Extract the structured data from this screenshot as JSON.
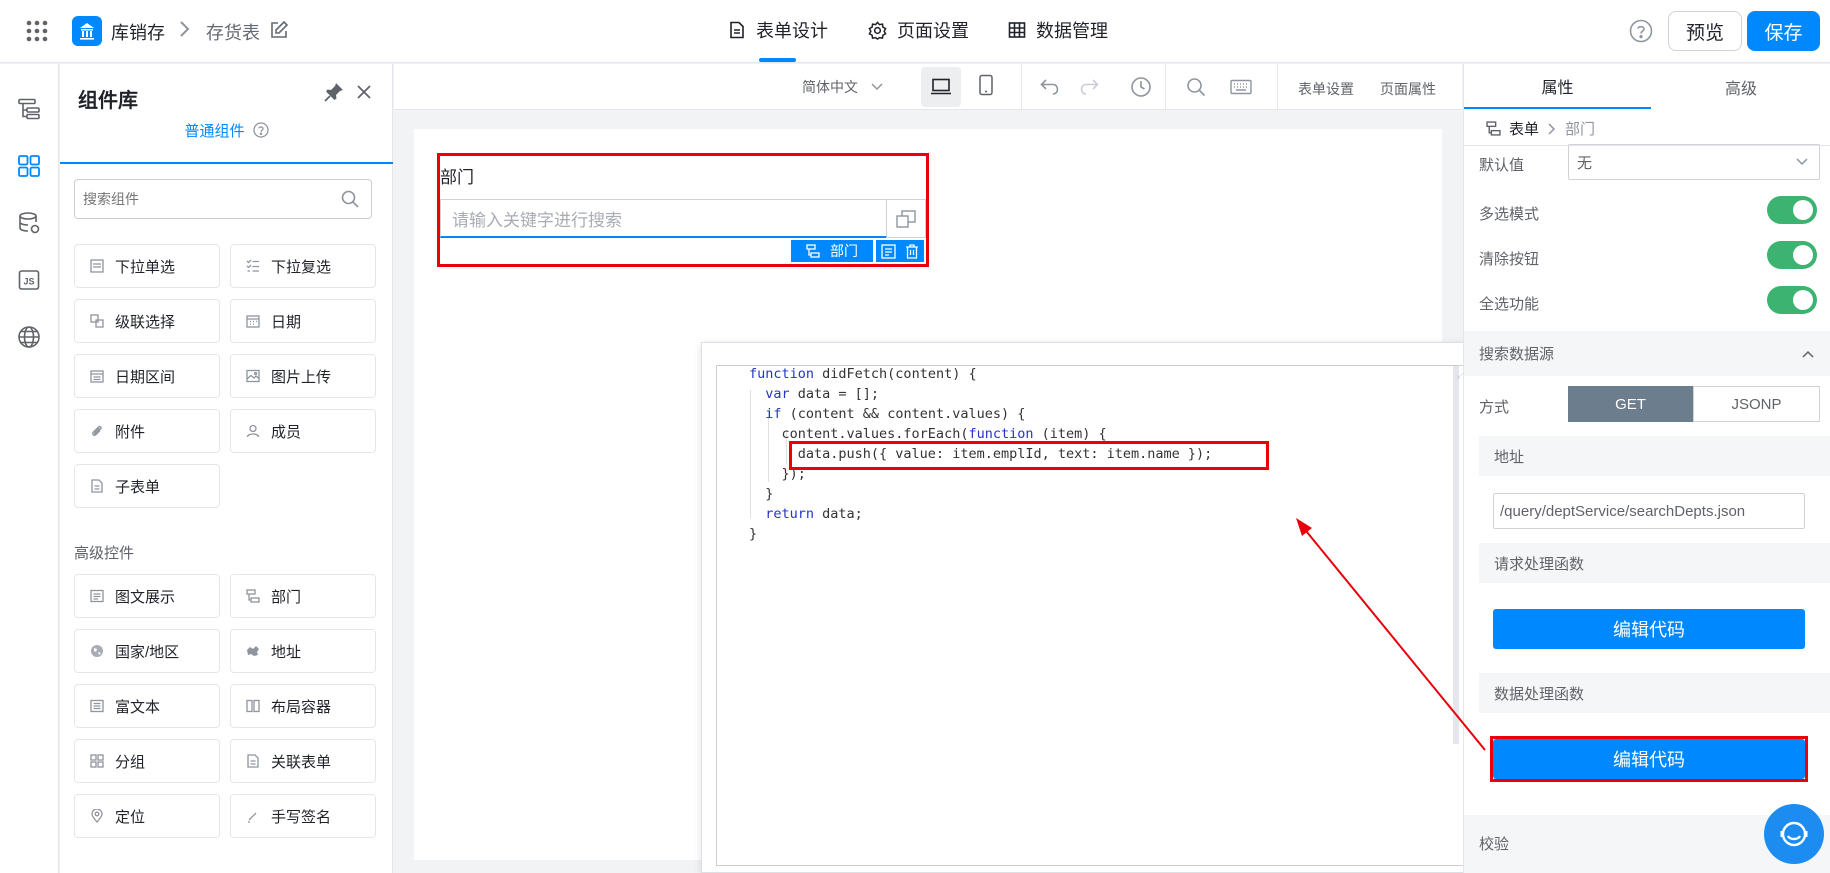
{
  "topbar": {
    "app_name": "库销存",
    "page_name": "存货表",
    "tabs": [
      {
        "label": "表单设计",
        "active": true
      },
      {
        "label": "页面设置",
        "active": false
      },
      {
        "label": "数据管理",
        "active": false
      }
    ],
    "preview_label": "预览",
    "save_label": "保存"
  },
  "panel": {
    "title": "组件库",
    "tab_label": "普通组件",
    "search_placeholder": "搜索组件",
    "basic_components": [
      "下拉单选",
      "下拉复选",
      "级联选择",
      "日期",
      "日期区间",
      "图片上传",
      "附件",
      "成员",
      "子表单"
    ],
    "advanced_title": "高级控件",
    "advanced_components": [
      "图文展示",
      "部门",
      "国家/地区",
      "地址",
      "富文本",
      "布局容器",
      "分组",
      "关联表单",
      "定位",
      "手写签名"
    ]
  },
  "canvasbar": {
    "language": "简体中文",
    "form_settings": "表单设置",
    "page_props": "页面属性"
  },
  "field": {
    "label": "部门",
    "placeholder": "请输入关键字进行搜索",
    "tag": "部门"
  },
  "code_lines": [
    "function didFetch(content) {",
    "  var data = [];",
    "  if (content && content.values) {",
    "    content.values.forEach(function (item) {",
    "      data.push({ value: item.emplId, text: item.name });",
    "    });",
    "  }",
    "  return data;",
    "}"
  ],
  "right": {
    "tab_props": "属性",
    "tab_adv": "高级",
    "crumb_root": "表单",
    "crumb_leaf": "部门",
    "default_label": "默认值",
    "default_value": "无",
    "multi_label": "多选模式",
    "clear_label": "清除按钮",
    "selectall_label": "全选功能",
    "search_source": "搜索数据源",
    "method_label": "方式",
    "method_get": "GET",
    "method_jsonp": "JSONP",
    "address_label": "地址",
    "address_value": "/query/deptService/searchDepts.json",
    "request_fn": "请求处理函数",
    "edit_code": "编辑代码",
    "data_fn": "数据处理函数",
    "edit_code_2": "编辑代码",
    "validate": "校验"
  },
  "colors": {
    "accent": "#0089ff",
    "highlight": "#e8000b",
    "toggle_on": "#3cb371"
  }
}
